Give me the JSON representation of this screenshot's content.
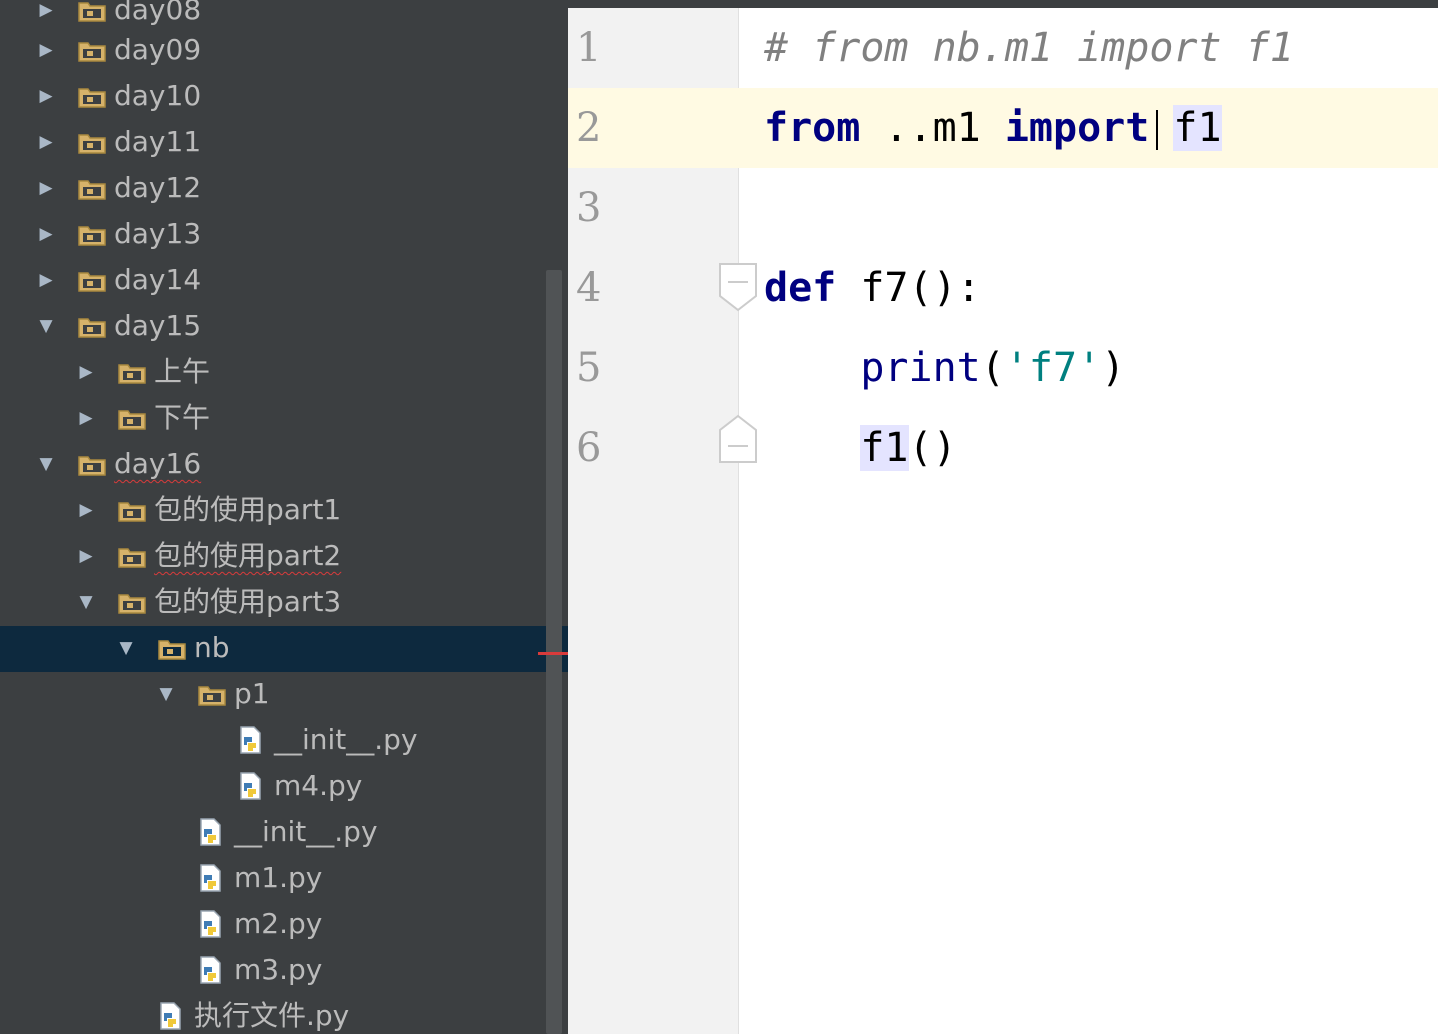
{
  "project_tree": {
    "items": [
      {
        "label": "day08",
        "type": "folder",
        "depth": 0,
        "expanded": false
      },
      {
        "label": "day09",
        "type": "folder",
        "depth": 0,
        "expanded": false
      },
      {
        "label": "day10",
        "type": "folder",
        "depth": 0,
        "expanded": false
      },
      {
        "label": "day11",
        "type": "folder",
        "depth": 0,
        "expanded": false
      },
      {
        "label": "day12",
        "type": "folder",
        "depth": 0,
        "expanded": false
      },
      {
        "label": "day13",
        "type": "folder",
        "depth": 0,
        "expanded": false
      },
      {
        "label": "day14",
        "type": "folder",
        "depth": 0,
        "expanded": false
      },
      {
        "label": "day15",
        "type": "folder",
        "depth": 0,
        "expanded": true
      },
      {
        "label": "上午",
        "type": "folder",
        "depth": 1,
        "expanded": false
      },
      {
        "label": "下午",
        "type": "folder",
        "depth": 1,
        "expanded": false
      },
      {
        "label": "day16",
        "type": "folder",
        "depth": 0,
        "expanded": true
      },
      {
        "label": "包的使用part1",
        "type": "folder",
        "depth": 1,
        "expanded": false
      },
      {
        "label": "包的使用part2",
        "type": "folder",
        "depth": 1,
        "expanded": false
      },
      {
        "label": "包的使用part3",
        "type": "folder",
        "depth": 1,
        "expanded": true
      },
      {
        "label": "nb",
        "type": "folder",
        "depth": 2,
        "expanded": true,
        "selected": true
      },
      {
        "label": "p1",
        "type": "folder",
        "depth": 3,
        "expanded": true
      },
      {
        "label": "__init__.py",
        "type": "py",
        "depth": 4
      },
      {
        "label": "m4.py",
        "type": "py",
        "depth": 4
      },
      {
        "label": "__init__.py",
        "type": "py",
        "depth": 3
      },
      {
        "label": "m1.py",
        "type": "py",
        "depth": 3
      },
      {
        "label": "m2.py",
        "type": "py",
        "depth": 3
      },
      {
        "label": "m3.py",
        "type": "py",
        "depth": 3
      },
      {
        "label": "执行文件.py",
        "type": "py",
        "depth": 2
      }
    ]
  },
  "editor": {
    "current_line": 2,
    "lines": [
      {
        "number": "1",
        "text": "# from nb.m1 import f1"
      },
      {
        "number": "2",
        "text": "from ..m1 import f1"
      },
      {
        "number": "3",
        "text": ""
      },
      {
        "number": "4",
        "text": "def f7():"
      },
      {
        "number": "5",
        "text": "    print('f7')"
      },
      {
        "number": "6",
        "text": "    f1()"
      }
    ]
  },
  "colors": {
    "tree_bg": "#3c3f41",
    "tree_selected": "#0d293e",
    "keyword": "#000080",
    "string": "#008080",
    "comment": "#808080",
    "current_line": "#fffae3",
    "usage_highlight": "#e4e4ff"
  }
}
